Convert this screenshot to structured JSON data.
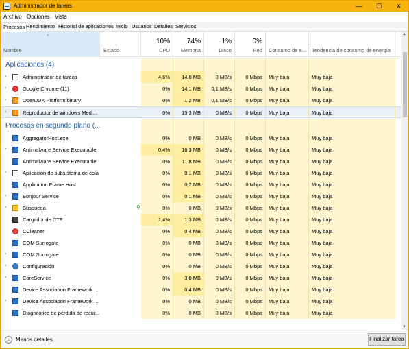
{
  "window": {
    "title": "Administrador de tareas",
    "minimize": "—",
    "maximize": "☐",
    "close": "✕"
  },
  "menu": [
    "Archivo",
    "Opciones",
    "Vista"
  ],
  "tabs": [
    "Procesos",
    "Rendimiento",
    "Historial de aplicaciones",
    "Inicio",
    "Usuarios",
    "Detalles",
    "Servicios"
  ],
  "header": {
    "sort_arrow": "^",
    "columns": [
      {
        "label": "Nombre",
        "pct": ""
      },
      {
        "label": "Estado",
        "pct": ""
      },
      {
        "label": "CPU",
        "pct": "10%"
      },
      {
        "label": "Memoria",
        "pct": "74%"
      },
      {
        "label": "Disco",
        "pct": "1%"
      },
      {
        "label": "Red",
        "pct": "0%"
      },
      {
        "label": "Consumo de e...",
        "pct": ""
      },
      {
        "label": "Tendencia de consumo de energía",
        "pct": ""
      }
    ]
  },
  "groups": [
    {
      "title": "Aplicaciones (4)",
      "rows": [
        {
          "name": "Administrador de tareas",
          "icon": "task-manager-icon",
          "expandable": true,
          "cpu": "4,6%",
          "mem": "14,8 MB",
          "disk": "0 MB/s",
          "net": "0 Mbps",
          "power": "Muy baja",
          "trend": "Muy baja"
        },
        {
          "name": "Google Chrome (11)",
          "icon": "chrome-icon",
          "expandable": true,
          "cpu": "0%",
          "mem": "14,1 MB",
          "disk": "0,1 MB/s",
          "net": "0 Mbps",
          "power": "Muy baja",
          "trend": "Muy baja"
        },
        {
          "name": "OpenJDK Platform binary",
          "icon": "java-icon",
          "expandable": true,
          "cpu": "0%",
          "mem": "1,2 MB",
          "disk": "0,1 MB/s",
          "net": "0 Mbps",
          "power": "Muy baja",
          "trend": "Muy baja"
        },
        {
          "name": "Reproductor de Windows Medi...",
          "icon": "media-player-icon",
          "expandable": true,
          "cpu": "0%",
          "mem": "15,3 MB",
          "disk": "0 MB/s",
          "net": "0 Mbps",
          "power": "Muy baja",
          "trend": "Muy baja",
          "selected": true
        }
      ]
    },
    {
      "title": "Procesos en segundo plano (...",
      "rows": [
        {
          "name": "AggregatorHost.exe",
          "icon": "process-icon",
          "expandable": false,
          "cpu": "0%",
          "mem": "0 MB",
          "disk": "0 MB/s",
          "net": "0 Mbps",
          "power": "Muy baja",
          "trend": "Muy baja"
        },
        {
          "name": "Antimalware Service Executable",
          "icon": "process-icon",
          "expandable": true,
          "cpu": "0,4%",
          "mem": "16,3 MB",
          "disk": "0 MB/s",
          "net": "0 Mbps",
          "power": "Muy baja",
          "trend": "Muy baja"
        },
        {
          "name": "Antimalware Service Executable ...",
          "icon": "process-icon",
          "expandable": false,
          "cpu": "0%",
          "mem": "11,8 MB",
          "disk": "0 MB/s",
          "net": "0 Mbps",
          "power": "Muy baja",
          "trend": "Muy baja"
        },
        {
          "name": "Aplicación de subsistema de cola",
          "icon": "printer-icon",
          "expandable": true,
          "cpu": "0%",
          "mem": "0,1 MB",
          "disk": "0 MB/s",
          "net": "0 Mbps",
          "power": "Muy baja",
          "trend": "Muy baja"
        },
        {
          "name": "Application Frame Host",
          "icon": "process-icon",
          "expandable": false,
          "cpu": "0%",
          "mem": "0,2 MB",
          "disk": "0 MB/s",
          "net": "0 Mbps",
          "power": "Muy baja",
          "trend": "Muy baja"
        },
        {
          "name": "Bonjour Service",
          "icon": "process-icon",
          "expandable": true,
          "cpu": "0%",
          "mem": "0,1 MB",
          "disk": "0 MB/s",
          "net": "0 Mbps",
          "power": "Muy baja",
          "trend": "Muy baja"
        },
        {
          "name": "Búsqueda",
          "icon": "search-icon",
          "expandable": true,
          "leaf": true,
          "cpu": "0%",
          "mem": "0 MB",
          "disk": "0 MB/s",
          "net": "0 Mbps",
          "power": "Muy baja",
          "trend": "Muy baja"
        },
        {
          "name": "Cargador de CTF",
          "icon": "ctf-icon",
          "expandable": false,
          "cpu": "1,4%",
          "mem": "1,3 MB",
          "disk": "0 MB/s",
          "net": "0 Mbps",
          "power": "Muy baja",
          "trend": "Muy baja"
        },
        {
          "name": "CCleaner",
          "icon": "ccleaner-icon",
          "expandable": false,
          "cpu": "0%",
          "mem": "0,4 MB",
          "disk": "0 MB/s",
          "net": "0 Mbps",
          "power": "Muy baja",
          "trend": "Muy baja"
        },
        {
          "name": "COM Surrogate",
          "icon": "process-icon",
          "expandable": false,
          "cpu": "0%",
          "mem": "0 MB",
          "disk": "0 MB/s",
          "net": "0 Mbps",
          "power": "Muy baja",
          "trend": "Muy baja"
        },
        {
          "name": "COM Surrogate",
          "icon": "process-icon",
          "expandable": true,
          "cpu": "0%",
          "mem": "0 MB",
          "disk": "0 MB/s",
          "net": "0 Mbps",
          "power": "Muy baja",
          "trend": "Muy baja"
        },
        {
          "name": "Configuración",
          "icon": "gear-icon",
          "expandable": true,
          "cpu": "0%",
          "mem": "0 MB",
          "disk": "0 MB/s",
          "net": "0 Mbps",
          "power": "Muy baja",
          "trend": "Muy baja"
        },
        {
          "name": "CoreService",
          "icon": "process-icon",
          "expandable": true,
          "cpu": "0%",
          "mem": "3,8 MB",
          "disk": "0 MB/s",
          "net": "0 Mbps",
          "power": "Muy baja",
          "trend": "Muy baja"
        },
        {
          "name": "Device Association Framework ...",
          "icon": "process-icon",
          "expandable": false,
          "cpu": "0%",
          "mem": "0,4 MB",
          "disk": "0 MB/s",
          "net": "0 Mbps",
          "power": "Muy baja",
          "trend": "Muy baja"
        },
        {
          "name": "Device Association Framework ...",
          "icon": "process-icon",
          "expandable": true,
          "cpu": "0%",
          "mem": "0 MB",
          "disk": "0 MB/s",
          "net": "0 Mbps",
          "power": "Muy baja",
          "trend": "Muy baja"
        },
        {
          "name": "Diagnóstico de pérdida de recur...",
          "icon": "process-icon",
          "expandable": false,
          "cpu": "0%",
          "mem": "0 MB",
          "disk": "0 MB/s",
          "net": "0 Mbps",
          "power": "Muy baja",
          "trend": "Muy baja"
        }
      ]
    }
  ],
  "footer": {
    "fewer_details": "Menos detalles",
    "end_task": "Finalizar tarea"
  },
  "colors": {
    "titlebar": "#f7b20e",
    "heat_light": "#fff6cf",
    "heat_medium": "#ffeda0",
    "group_title": "#1f5fa8",
    "selected_row": "#e9f0f7"
  }
}
